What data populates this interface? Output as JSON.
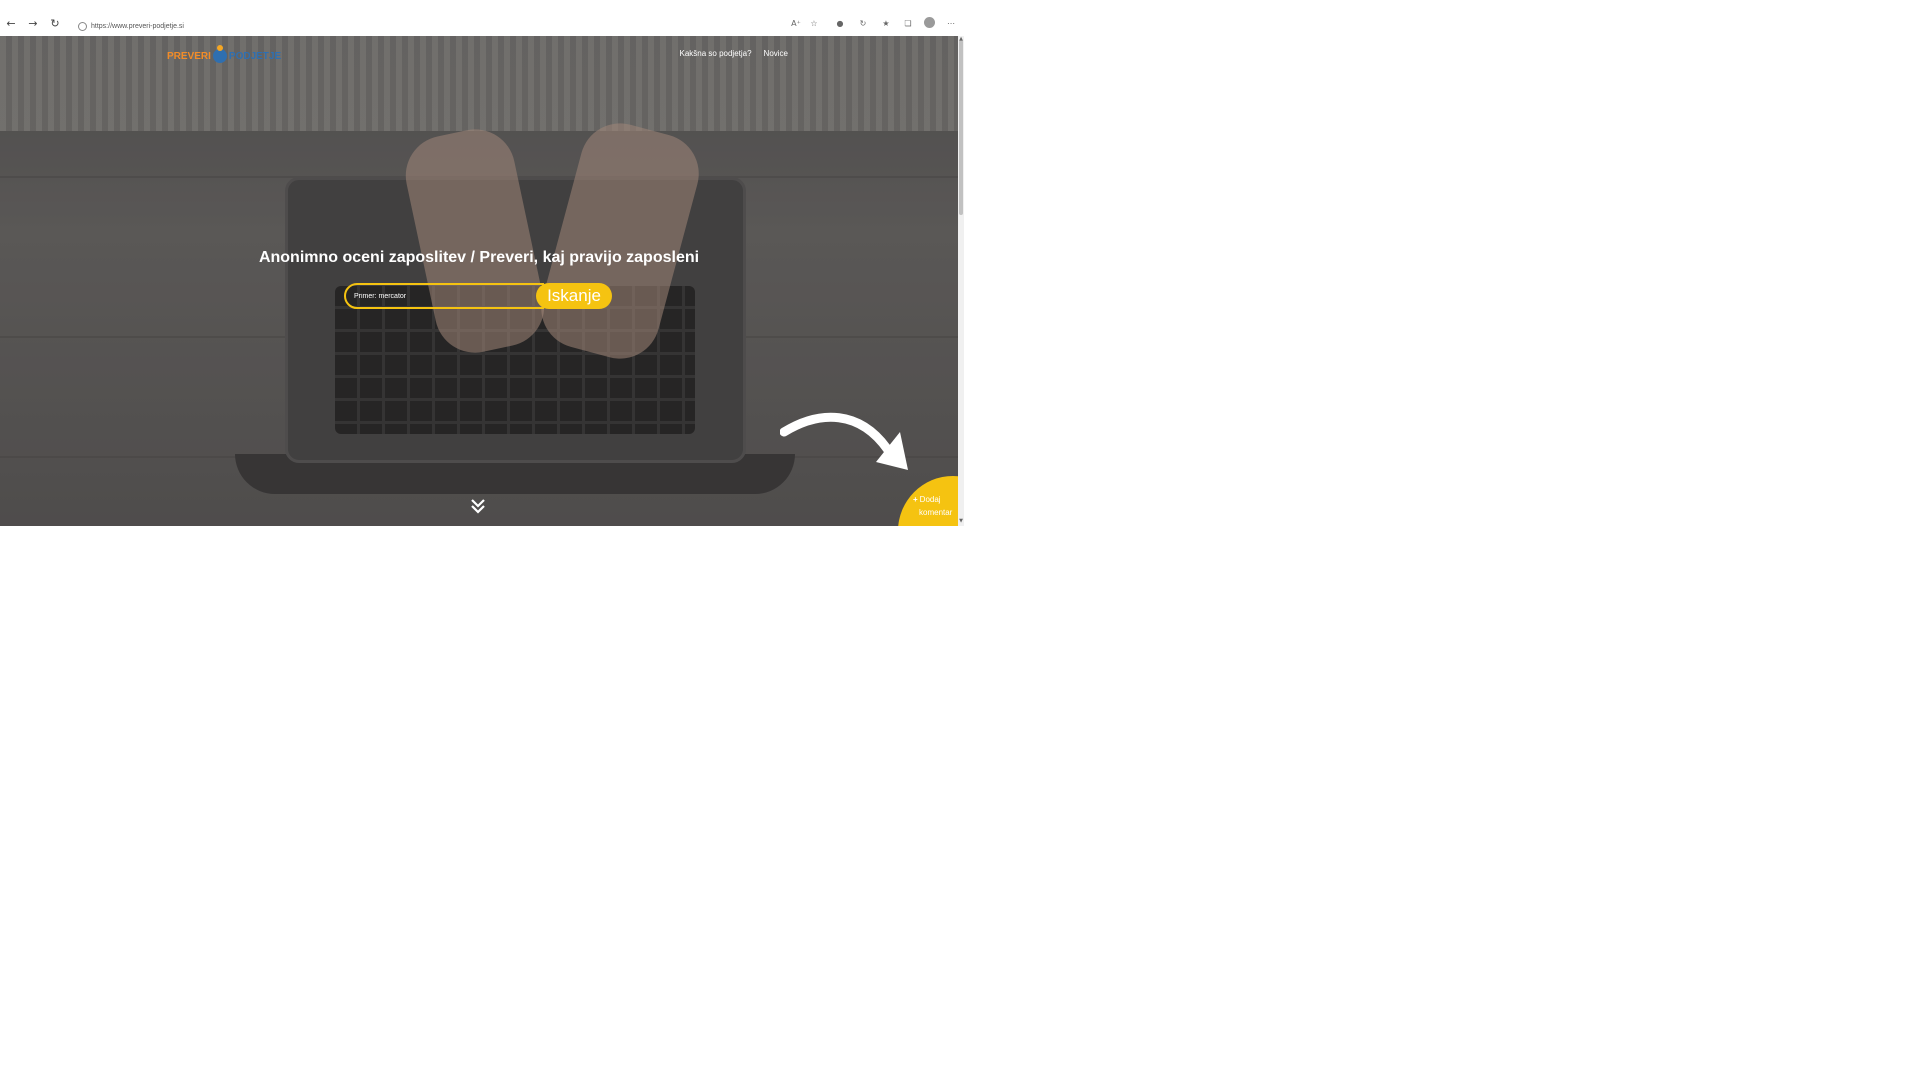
{
  "browser": {
    "url": "https://www.preveri-podjetje.si",
    "icons": [
      "back-icon",
      "forward-icon",
      "reload-icon",
      "site-info-icon",
      "read-aloud-icon",
      "add-favorite-icon",
      "extension-icon",
      "refresh-extension-icon",
      "favorites-icon",
      "collections-icon",
      "profile-icon",
      "more-icon"
    ]
  },
  "header": {
    "logo_part1": "PREVERI",
    "logo_part2": "PODJETJE",
    "nav": [
      {
        "label": "Kakšna so podjetja?"
      },
      {
        "label": "Novice"
      }
    ]
  },
  "hero": {
    "headline": "Anonimno oceni zaposlitev / Preveri, kaj pravijo zaposleni",
    "search_placeholder": "Primer: mercator",
    "search_button": "Iskanje"
  },
  "fab": {
    "plus": "+",
    "line1": "Dodaj",
    "line2": "komentar"
  },
  "colors": {
    "accent": "#f5c311",
    "logo_orange": "#f28c28",
    "logo_blue": "#2f6fb0"
  }
}
